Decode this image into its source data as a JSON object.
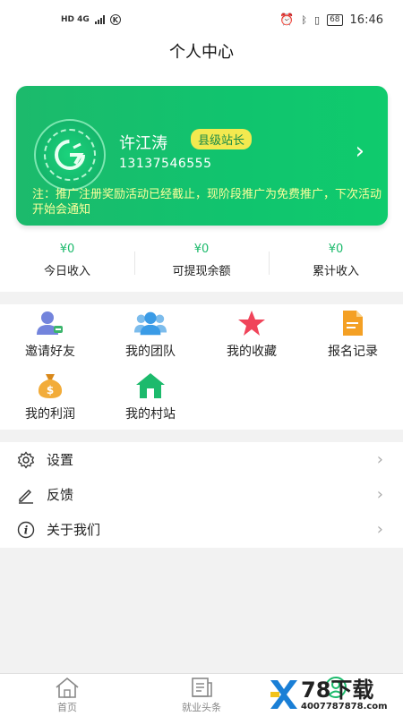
{
  "status_bar": {
    "left_text": "HD 4G",
    "time": "16:46",
    "battery": "68"
  },
  "header": {
    "title": "个人中心"
  },
  "profile_card": {
    "name": "许江涛",
    "badge": "县级站长",
    "phone": "13137546555",
    "note": "注：推广注册奖励活动已经截止，现阶段推广为免费推广，下次活动开始会通知",
    "arrow": "›"
  },
  "stats": [
    {
      "value": "¥0",
      "label": "今日收入"
    },
    {
      "value": "¥0",
      "label": "可提现余额"
    },
    {
      "value": "¥0",
      "label": "累计收入"
    }
  ],
  "grid": [
    {
      "label": "邀请好友",
      "icon": "invite-friend-icon",
      "color": "#6d7fd8"
    },
    {
      "label": "我的团队",
      "icon": "team-icon",
      "color": "#4da7e8"
    },
    {
      "label": "我的收藏",
      "icon": "star-icon",
      "color": "#f0445a"
    },
    {
      "label": "报名记录",
      "icon": "document-icon",
      "color": "#f4a024"
    },
    {
      "label": "我的利润",
      "icon": "money-bag-icon",
      "color": "#f0a930"
    },
    {
      "label": "我的村站",
      "icon": "house-icon",
      "color": "#1cba6c"
    }
  ],
  "menu": [
    {
      "label": "设置",
      "icon": "gear-icon"
    },
    {
      "label": "反馈",
      "icon": "pencil-icon"
    },
    {
      "label": "关于我们",
      "icon": "info-icon"
    }
  ],
  "tabs": [
    {
      "label": "首页",
      "icon": "home-icon"
    },
    {
      "label": "就业头条",
      "icon": "news-icon"
    },
    {
      "label": "",
      "icon": "profile-icon"
    }
  ],
  "watermark": {
    "text": "78下载",
    "url": "4007787878.com"
  },
  "colors": {
    "brand": "#1cba6c",
    "badge_bg": "#f3e94f",
    "note": "#fbff9c"
  }
}
